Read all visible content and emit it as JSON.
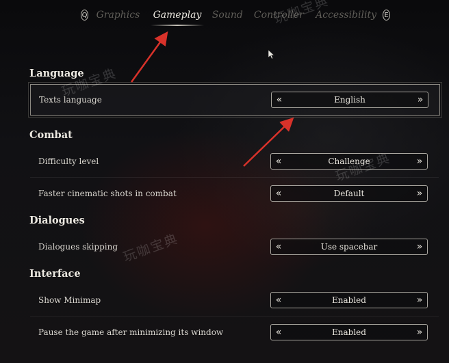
{
  "tabs": {
    "prev_key": "Q",
    "next_key": "E",
    "items": [
      "Graphics",
      "Gameplay",
      "Sound",
      "Controller",
      "Accessibility"
    ],
    "active": "Gameplay"
  },
  "sections": [
    {
      "title": "Language",
      "rows": [
        {
          "label": "Texts language",
          "value": "English"
        }
      ]
    },
    {
      "title": "Combat",
      "rows": [
        {
          "label": "Difficulty level",
          "value": "Challenge"
        },
        {
          "label": "Faster cinematic shots in combat",
          "value": "Default"
        }
      ]
    },
    {
      "title": "Dialogues",
      "rows": [
        {
          "label": "Dialogues skipping",
          "value": "Use spacebar"
        }
      ]
    },
    {
      "title": "Interface",
      "rows": [
        {
          "label": "Show Minimap",
          "value": "Enabled"
        },
        {
          "label": "Pause the game after minimizing its window",
          "value": "Enabled"
        }
      ]
    }
  ],
  "selector_icons": {
    "left": "double-chevron-left-icon",
    "right": "double-chevron-right-icon"
  },
  "watermark": "玩咖宝典",
  "colors": {
    "accent_red": "#d8322a",
    "text": "#d9d6cf",
    "inactive_tab": "#5f5d58"
  }
}
